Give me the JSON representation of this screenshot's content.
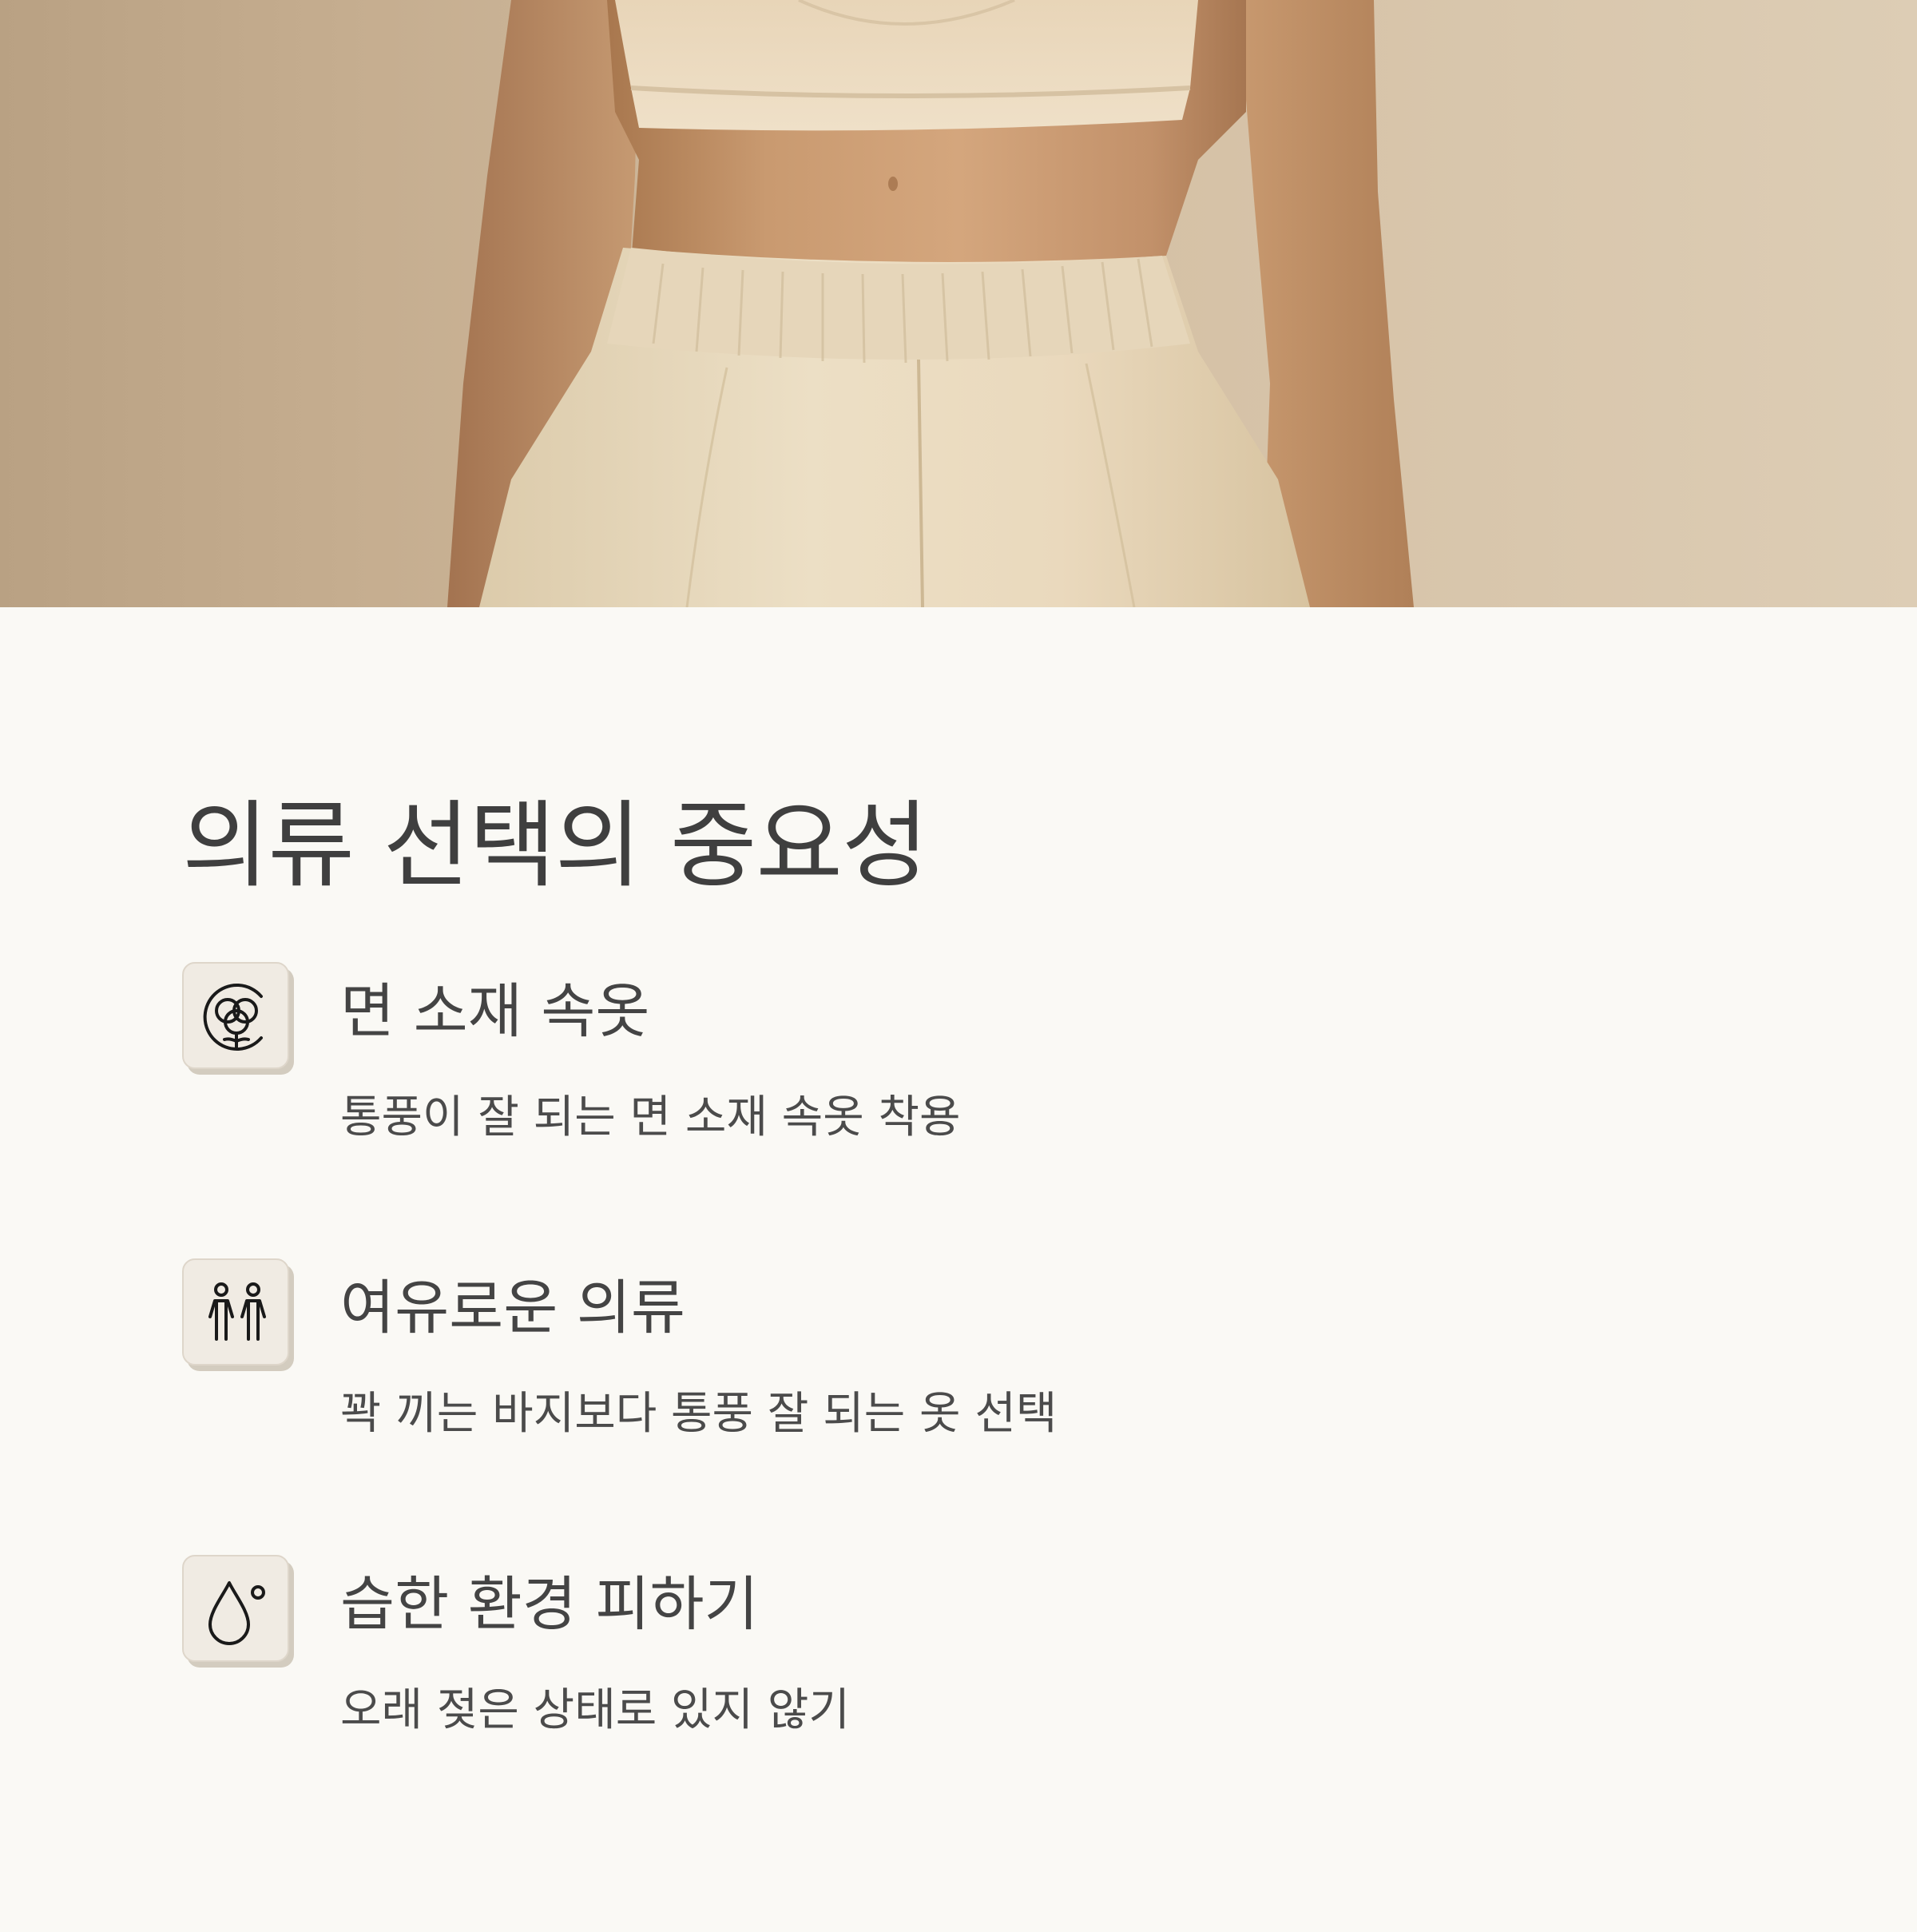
{
  "hero": {
    "image": "woman-torso-beige-sports-bra-linen-pants-photo"
  },
  "main": {
    "title": "의류 선택의 중요성",
    "features": [
      {
        "icon": "cotton-flower-icon",
        "title": "면 소재 속옷",
        "description": "통풍이 잘 되는 면 소재 속옷 착용"
      },
      {
        "icon": "two-people-icon",
        "title": "여유로운 의류",
        "description": "꽉 끼는 바지보다 통풍 잘 되는 옷 선택"
      },
      {
        "icon": "water-drop-icon",
        "title": "습한 환경 피하기",
        "description": "오래 젖은 상태로 있지 않기"
      }
    ]
  },
  "colors": {
    "background": "#faf9f5",
    "icon_box": "#f0ebe3",
    "icon_box_shadow": "#d3ccbf",
    "text": "#444444"
  }
}
